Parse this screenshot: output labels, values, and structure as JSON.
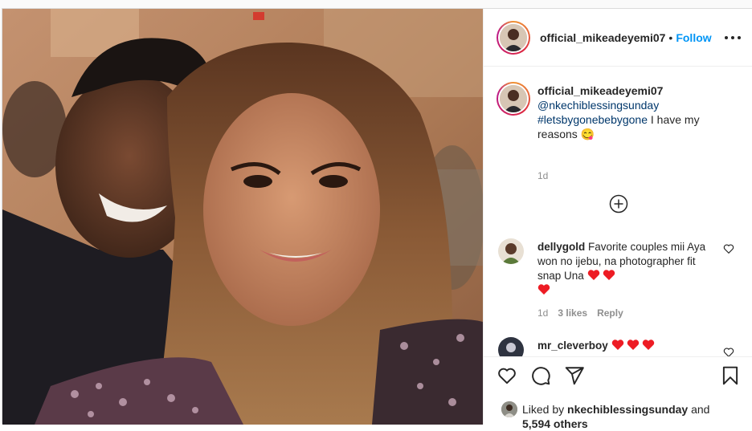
{
  "post": {
    "username": "official_mikeadeyemi07",
    "follow_label": "Follow",
    "dot": "•",
    "more_icon": "more-horizontal-icon"
  },
  "caption": {
    "username": "official_mikeadeyemi07",
    "mention": "@nkechiblessingsunday",
    "hashtag": "#letsbygonebebygone",
    "text": " I have my reasons ",
    "emoji": "😋",
    "time": "1d"
  },
  "load_more_icon": "plus-circle-icon",
  "comments": [
    {
      "username": "dellygold",
      "text": "Favorite couples mii Aya won no ijebu, na photographer fit snap Una",
      "hearts_inline": 2,
      "hearts_after": 1,
      "time": "1d",
      "likes": "3 likes",
      "reply": "Reply"
    },
    {
      "username": "mr_cleverboy",
      "hearts_inline": 3
    }
  ],
  "actions": {
    "like_icon": "heart-icon",
    "comment_icon": "comment-icon",
    "share_icon": "share-icon",
    "save_icon": "bookmark-icon"
  },
  "likes": {
    "prefix": "Liked by ",
    "user": "nkechiblessingsunday",
    "mid": " and",
    "count": "5,594 others"
  },
  "colors": {
    "link_blue": "#0095f6",
    "tag_blue": "#00376b",
    "heart_red": "#ed1c24",
    "muted": "#8e8e8e"
  }
}
